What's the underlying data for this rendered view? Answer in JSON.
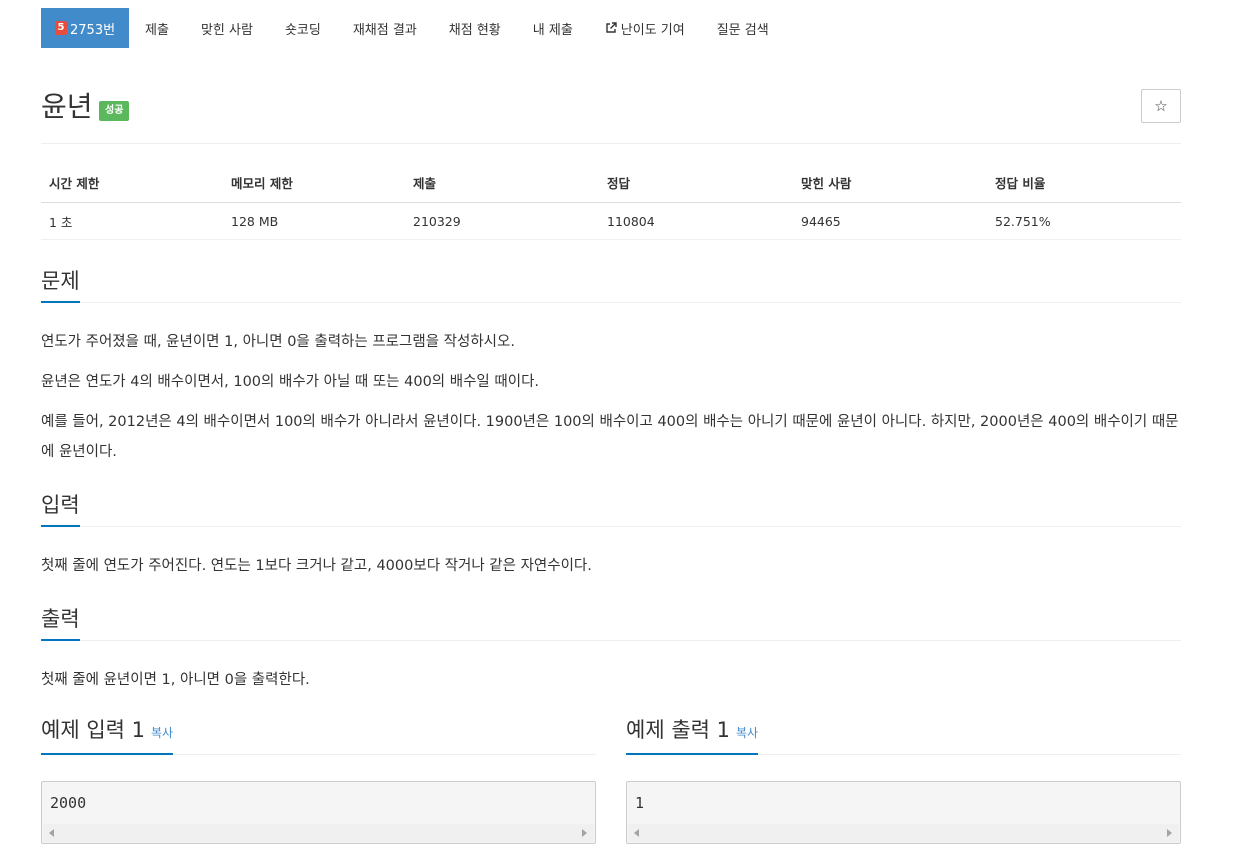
{
  "nav": {
    "problem_number_badge": "5",
    "problem_number": "2753번",
    "items": [
      "제출",
      "맞힌 사람",
      "숏코딩",
      "재채점 결과",
      "채점 현황",
      "내 제출",
      "난이도 기여",
      "질문 검색"
    ]
  },
  "problem": {
    "title": "윤년",
    "result_badge": "성공",
    "star": "☆"
  },
  "info_table": {
    "headers": [
      "시간 제한",
      "메모리 제한",
      "제출",
      "정답",
      "맞힌 사람",
      "정답 비율"
    ],
    "values": [
      "1 초",
      "128 MB",
      "210329",
      "110804",
      "94465",
      "52.751%"
    ]
  },
  "sections": {
    "description": {
      "title": "문제",
      "paragraphs": [
        "연도가 주어졌을 때, 윤년이면 1, 아니면 0을 출력하는 프로그램을 작성하시오.",
        "윤년은 연도가 4의 배수이면서, 100의 배수가 아닐 때 또는 400의 배수일 때이다.",
        "예를 들어, 2012년은 4의 배수이면서 100의 배수가 아니라서 윤년이다. 1900년은 100의 배수이고 400의 배수는 아니기 때문에 윤년이 아니다. 하지만, 2000년은 400의 배수이기 때문에 윤년이다."
      ]
    },
    "input": {
      "title": "입력",
      "text": "첫째 줄에 연도가 주어진다. 연도는 1보다 크거나 같고, 4000보다 작거나 같은 자연수이다."
    },
    "output": {
      "title": "출력",
      "text": "첫째 줄에 윤년이면 1, 아니면 0을 출력한다."
    }
  },
  "samples": {
    "input": {
      "title": "예제 입력 1",
      "copy": "복사",
      "content": "2000"
    },
    "output": {
      "title": "예제 출력 1",
      "copy": "복사",
      "content": "1"
    }
  },
  "colors": {
    "nav_active": "#428bca",
    "result_badge": "#5cb85c",
    "section_underline": "#0076c0",
    "copy_link": "#428bca",
    "number_badge": "#e74c3c"
  }
}
